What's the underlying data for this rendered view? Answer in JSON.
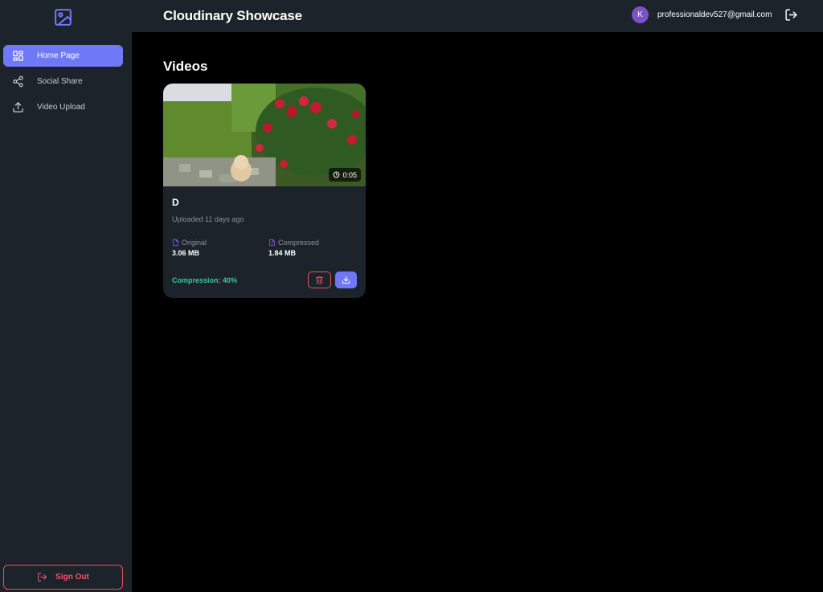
{
  "app": {
    "title": "Cloudinary Showcase"
  },
  "user": {
    "avatar_initial": "K",
    "email": "professionaldev527@gmail.com"
  },
  "sidebar": {
    "items": [
      {
        "label": "Home Page",
        "icon": "grid-icon",
        "active": true
      },
      {
        "label": "Social Share",
        "icon": "share-icon",
        "active": false
      },
      {
        "label": "Video Upload",
        "icon": "upload-icon",
        "active": false
      }
    ],
    "sign_out_label": "Sign Out"
  },
  "main": {
    "heading": "Videos",
    "videos": [
      {
        "title": "D",
        "uploaded": "Uploaded 11 days ago",
        "duration": "0:05",
        "original_label": "Original",
        "original_size": "3.06 MB",
        "compressed_label": "Compressed",
        "compressed_size": "1.84 MB",
        "compression": "Compression: 40%"
      }
    ]
  },
  "colors": {
    "accent": "#6f78f6",
    "danger": "#e05266",
    "success": "#35c9a4",
    "panel": "#1d232a",
    "background": "#000000"
  }
}
